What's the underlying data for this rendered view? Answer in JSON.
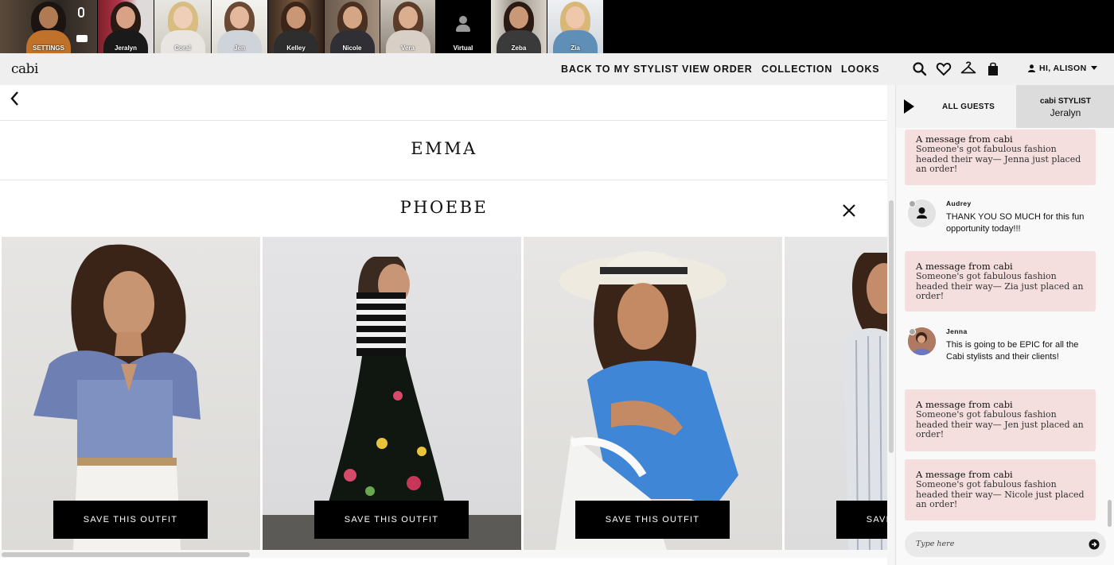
{
  "video_strip": {
    "tiles": [
      {
        "name": "SETTINGS"
      },
      {
        "name": "Jeralyn"
      },
      {
        "name": "Coral"
      },
      {
        "name": "Jen"
      },
      {
        "name": "Kelley"
      },
      {
        "name": "Nicole"
      },
      {
        "name": "Vera"
      },
      {
        "name": "Virtual"
      },
      {
        "name": "Zeba"
      },
      {
        "name": "Zia"
      }
    ]
  },
  "nav": {
    "logo": "cabi",
    "links": [
      "BACK TO MY STYLIST",
      "VIEW ORDER",
      "COLLECTION",
      "LOOKS"
    ],
    "icons": [
      "search-icon",
      "heart-icon",
      "hanger-icon",
      "bag-icon"
    ],
    "greeting": "HI, ALISON"
  },
  "main": {
    "collections": [
      "EMMA",
      "PHOEBE"
    ],
    "outfits": [
      {
        "button": "SAVE THIS OUTFIT"
      },
      {
        "button": "SAVE THIS OUTFIT"
      },
      {
        "button": "SAVE THIS OUTFIT"
      },
      {
        "button": "SAVE THIS OUTFIT"
      }
    ]
  },
  "chat": {
    "tab_all": "ALL GUESTS",
    "tab_stylist_title": "cabi STYLIST",
    "tab_stylist_name": "Jeralyn",
    "messages": [
      {
        "type": "cabi",
        "title": "A message from cabi",
        "body": "Someone's got fabulous fashion headed their way— Jenna just placed an order!"
      },
      {
        "type": "user",
        "name": "Audrey",
        "text": "THANK YOU SO MUCH for this fun opportunity today!!!"
      },
      {
        "type": "cabi",
        "title": "A message from cabi",
        "body": "Someone's got fabulous fashion headed their way— Zia just placed an order!"
      },
      {
        "type": "user",
        "name": "Jenna",
        "text": "This is going to be EPIC for all the Cabi stylists and their clients!"
      },
      {
        "type": "cabi",
        "title": "A message from cabi",
        "body": "Someone's got fabulous fashion headed their way— Jen just placed an order!"
      },
      {
        "type": "cabi",
        "title": "A message from cabi",
        "body": "Someone's got fabulous fashion headed their way— Nicole just placed an order!"
      }
    ],
    "input_placeholder": "Type here"
  }
}
